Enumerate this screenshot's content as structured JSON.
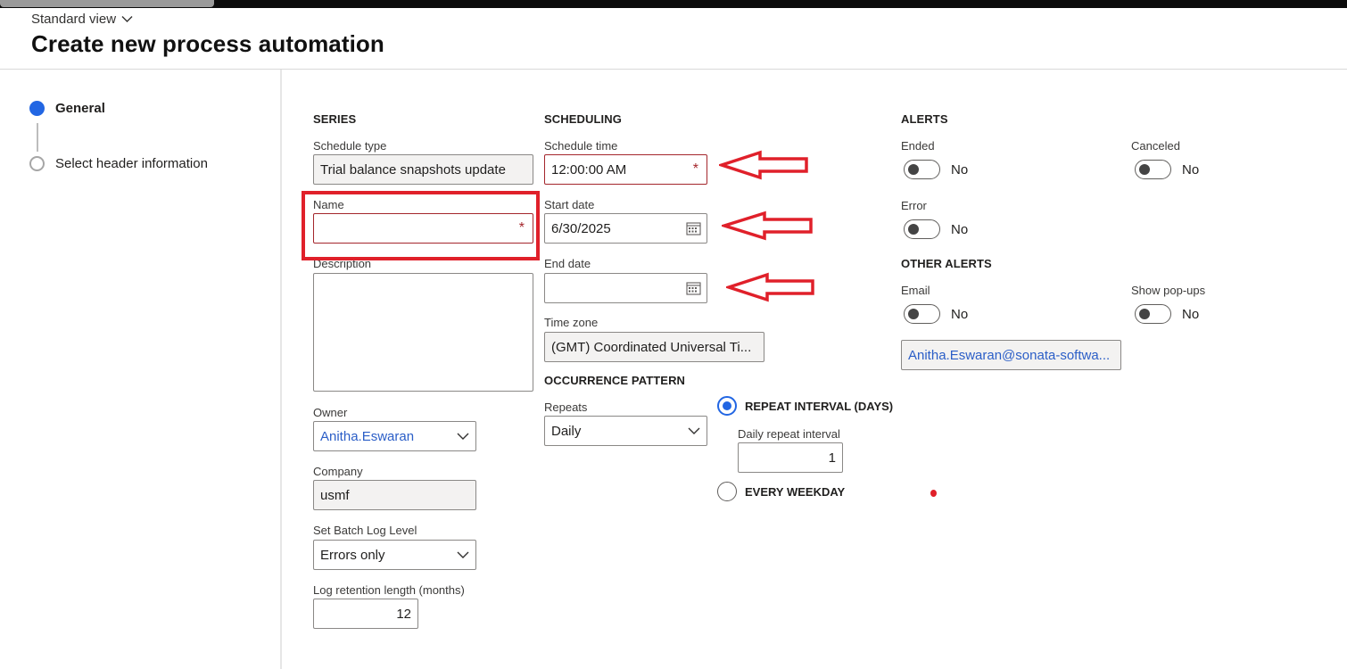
{
  "header": {
    "view_label": "Standard view",
    "title": "Create new process automation"
  },
  "steps": [
    {
      "label": "General",
      "active": true
    },
    {
      "label": "Select header information",
      "active": false
    }
  ],
  "series": {
    "heading": "SERIES",
    "schedule_type": {
      "label": "Schedule type",
      "value": "Trial balance snapshots update"
    },
    "name": {
      "label": "Name",
      "value": "",
      "required_mark": "*"
    },
    "description": {
      "label": "Description",
      "value": ""
    },
    "owner": {
      "label": "Owner",
      "value": "Anitha.Eswaran"
    },
    "company": {
      "label": "Company",
      "value": "usmf"
    },
    "batch_log_level": {
      "label": "Set Batch Log Level",
      "value": "Errors only"
    },
    "log_retention": {
      "label": "Log retention length (months)",
      "value": "12"
    }
  },
  "scheduling": {
    "heading": "SCHEDULING",
    "schedule_time": {
      "label": "Schedule time",
      "value": "12:00:00 AM",
      "required_mark": "*"
    },
    "start_date": {
      "label": "Start date",
      "value": "6/30/2025"
    },
    "end_date": {
      "label": "End date",
      "value": ""
    },
    "time_zone": {
      "label": "Time zone",
      "value": "(GMT) Coordinated Universal Ti..."
    }
  },
  "occurrence": {
    "heading": "OCCURRENCE PATTERN",
    "repeats": {
      "label": "Repeats",
      "value": "Daily"
    },
    "repeat_interval_option": {
      "label": "REPEAT INTERVAL (DAYS)",
      "selected": true
    },
    "daily_interval": {
      "label": "Daily repeat interval",
      "value": "1"
    },
    "every_weekday_option": {
      "label": "EVERY WEEKDAY",
      "selected": false
    }
  },
  "alerts": {
    "heading": "ALERTS",
    "ended": {
      "label": "Ended",
      "value": "No"
    },
    "canceled": {
      "label": "Canceled",
      "value": "No"
    },
    "error": {
      "label": "Error",
      "value": "No"
    }
  },
  "other_alerts": {
    "heading": "OTHER ALERTS",
    "email": {
      "label": "Email",
      "value": "No"
    },
    "show_popups": {
      "label": "Show pop-ups",
      "value": "No"
    },
    "email_address": "Anitha.Eswaran@sonata-softwa..."
  },
  "colors": {
    "accent": "#2266e3",
    "required": "#a4262c",
    "annotation": "#e0202a",
    "link": "#2b5ec7"
  }
}
